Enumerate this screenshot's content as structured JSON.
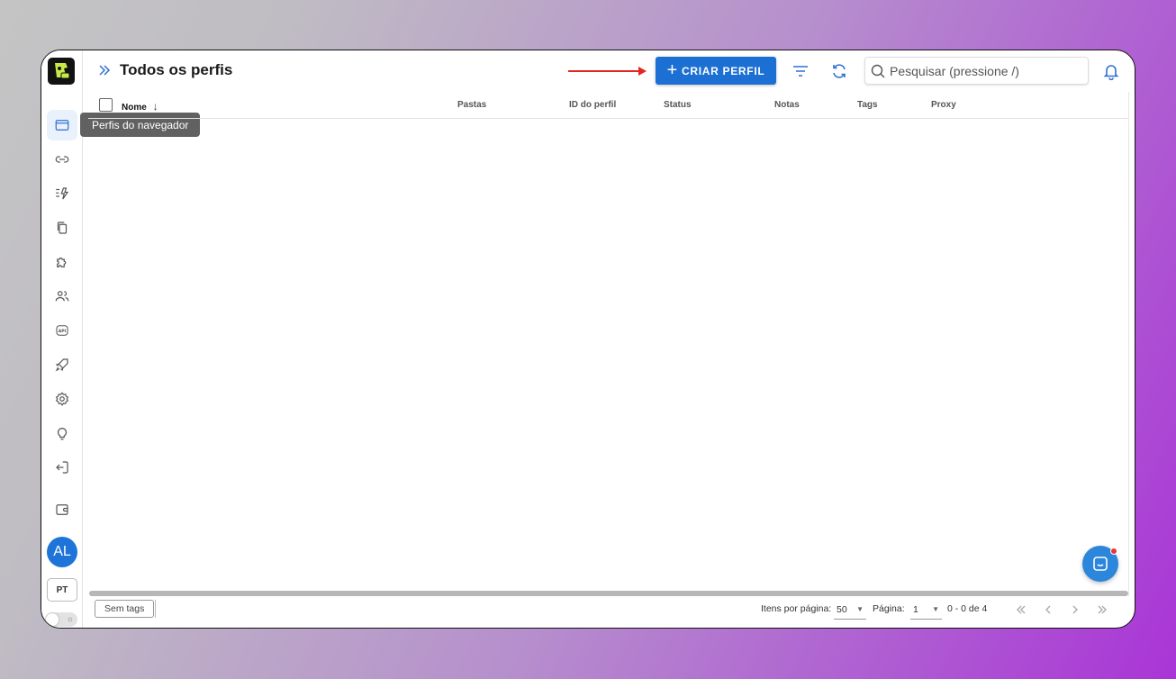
{
  "header": {
    "title": "Todos os perfis",
    "create_label": "CRIAR PERFIL",
    "search_placeholder": "Pesquisar (pressione /)"
  },
  "sidebar": {
    "tooltip": "Perfis do navegador",
    "avatar_initials": "AL",
    "language": "PT",
    "items": [
      {
        "icon": "browser-window-icon",
        "active": true
      },
      {
        "icon": "link-icon"
      },
      {
        "icon": "automation-bolt-icon"
      },
      {
        "icon": "copy-icon"
      },
      {
        "icon": "extension-puzzle-icon"
      },
      {
        "icon": "users-icon"
      },
      {
        "icon": "api-icon"
      },
      {
        "icon": "rocket-icon"
      },
      {
        "icon": "gear-icon"
      },
      {
        "icon": "lightbulb-icon"
      },
      {
        "icon": "logout-icon"
      },
      {
        "icon": "wallet-icon"
      }
    ]
  },
  "table": {
    "columns": [
      "Nome",
      "Pastas",
      "ID do perfil",
      "Status",
      "Notas",
      "Tags",
      "Proxy"
    ],
    "sort_column": "Nome",
    "sort_direction": "descending",
    "rows": []
  },
  "footer": {
    "tags_button": "Sem tags",
    "items_per_page_label": "Itens por página:",
    "items_per_page": "50",
    "page_label": "Página:",
    "page": "1",
    "range": "0 - 0 de 4"
  },
  "colors": {
    "accent": "#1c6fd3",
    "avatar": "#1e74d8",
    "annotation_arrow": "#e3261f",
    "chat": "#2b86dc"
  }
}
